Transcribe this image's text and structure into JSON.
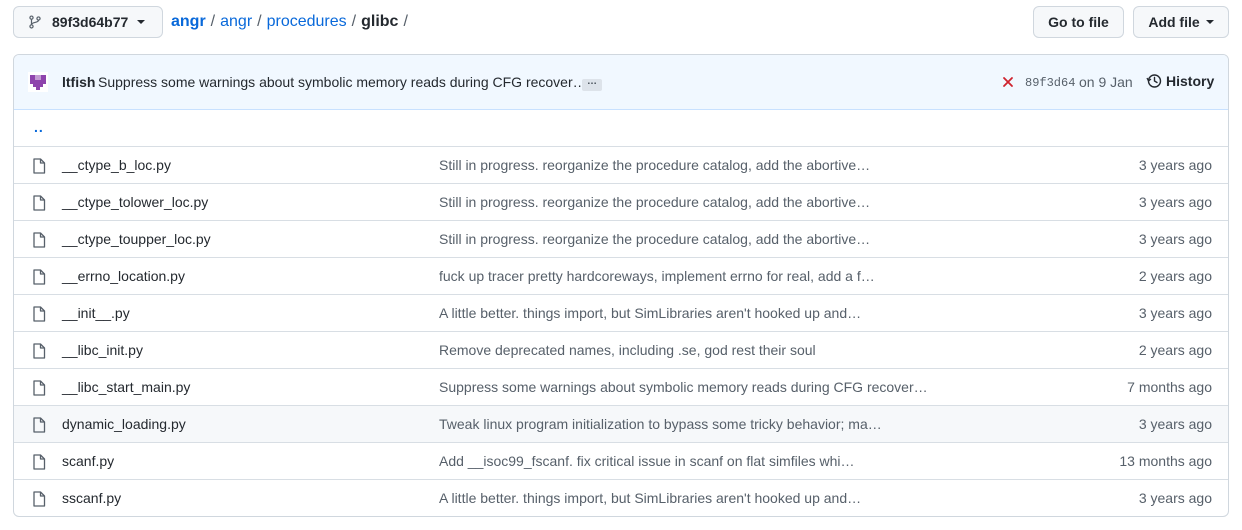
{
  "branch": {
    "name": "89f3d64b77",
    "icon": "git-branch-icon"
  },
  "breadcrumb": {
    "root": "angr",
    "segments": [
      "angr",
      "procedures"
    ],
    "current": "glibc",
    "separator": "/"
  },
  "actions": {
    "goto_label": "Go to file",
    "add_label": "Add file"
  },
  "commit": {
    "author": "ltfish",
    "message": "Suppress some warnings about symbolic memory reads during CFG recover…",
    "ellipsis": "…",
    "status": "failure",
    "sha": "89f3d64",
    "date": "on 9 Jan",
    "history_label": "History"
  },
  "parent_dir": "..",
  "files": [
    {
      "name": "__ctype_b_loc.py",
      "message": "Still in progress. reorganize the procedure catalog, add the abortive…",
      "age": "3 years ago"
    },
    {
      "name": "__ctype_tolower_loc.py",
      "message": "Still in progress. reorganize the procedure catalog, add the abortive…",
      "age": "3 years ago"
    },
    {
      "name": "__ctype_toupper_loc.py",
      "message": "Still in progress. reorganize the procedure catalog, add the abortive…",
      "age": "3 years ago"
    },
    {
      "name": "__errno_location.py",
      "message": "fuck up tracer pretty hardcoreways, implement errno for real, add a f…",
      "age": "2 years ago"
    },
    {
      "name": "__init__.py",
      "message": "A little better. things import, but SimLibraries aren't hooked up and…",
      "age": "3 years ago"
    },
    {
      "name": "__libc_init.py",
      "message": "Remove deprecated names, including .se, god rest their soul",
      "age": "2 years ago"
    },
    {
      "name": "__libc_start_main.py",
      "message": "Suppress some warnings about symbolic memory reads during CFG recover…",
      "age": "7 months ago"
    },
    {
      "name": "dynamic_loading.py",
      "message": "Tweak linux program initialization to bypass some tricky behavior; ma…",
      "age": "3 years ago"
    },
    {
      "name": "scanf.py",
      "message": "Add __isoc99_fscanf. fix critical issue in scanf on flat simfiles whi…",
      "age": "13 months ago"
    },
    {
      "name": "sscanf.py",
      "message": "A little better. things import, but SimLibraries aren't hooked up and…",
      "age": "3 years ago"
    }
  ],
  "colors": {
    "link": "#0969da",
    "muted": "#57606a",
    "failure": "#cf222e",
    "commit_bg": "#f1f8ff"
  }
}
